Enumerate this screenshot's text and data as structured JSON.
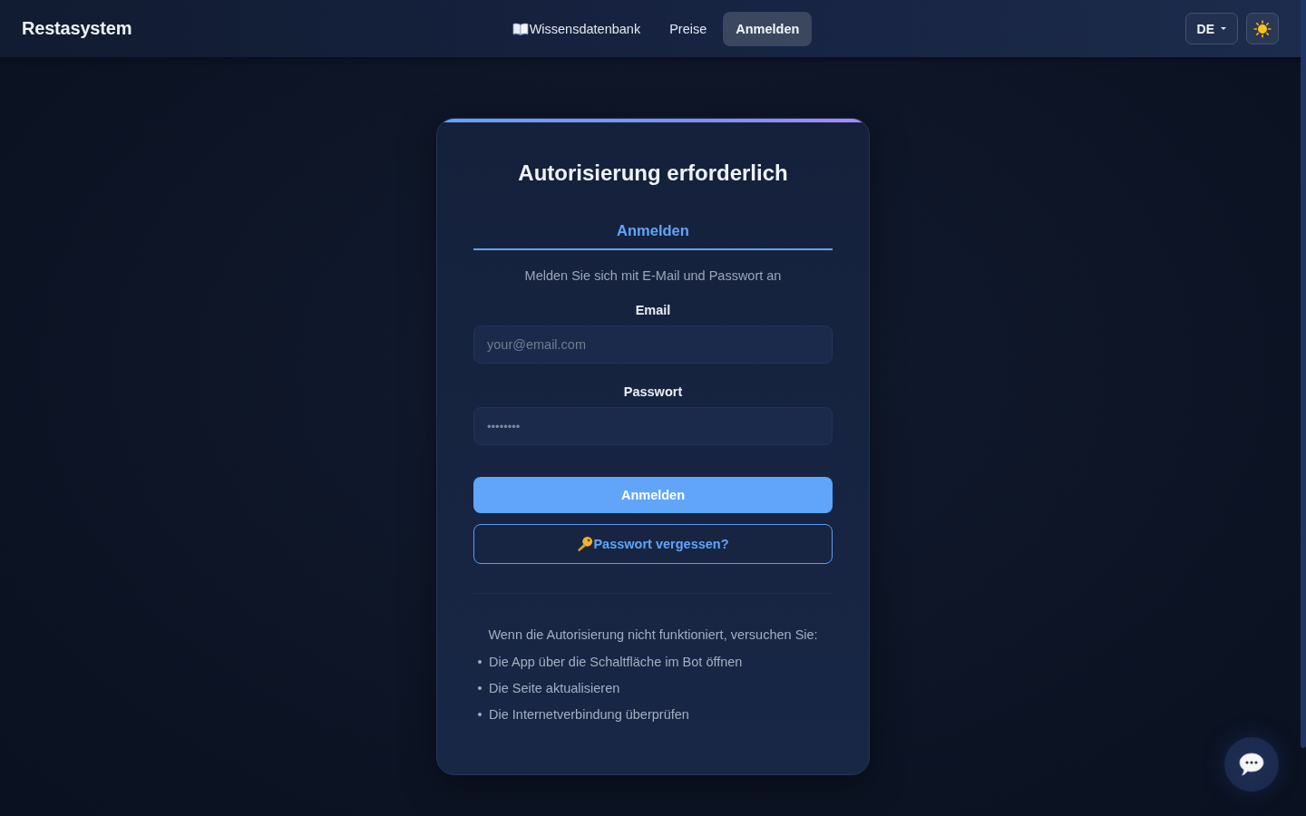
{
  "header": {
    "logo": "Restasystem",
    "nav": [
      {
        "label": "Wissensdatenbank",
        "kind": "icon",
        "selected": false
      },
      {
        "label": "Preise",
        "kind": "text",
        "selected": false
      },
      {
        "label": "Anmelden",
        "kind": "text",
        "selected": true
      }
    ],
    "language": "DE"
  },
  "login_card": {
    "title": "Autorisierung erforderlich",
    "tabs": [
      {
        "label": "Anmelden",
        "selected": true
      }
    ],
    "subtitle": "Melden Sie sich mit E-Mail und Passwort an",
    "fields": [
      {
        "label": "Email",
        "kind": "email",
        "placeholder": "your@email.com"
      },
      {
        "label": "Passwort",
        "kind": "password",
        "placeholder": "••••••••"
      }
    ],
    "submit_button": "Anmelden",
    "forgot_button": "Passwort vergessen?",
    "help": {
      "intro": "Wenn die Autorisierung nicht funktioniert, versuchen Sie:",
      "items": [
        "Die App über die Schaltfläche im Bot öffnen",
        "Die Seite aktualisieren",
        "Die Internetverbindung überprüfen"
      ]
    }
  }
}
